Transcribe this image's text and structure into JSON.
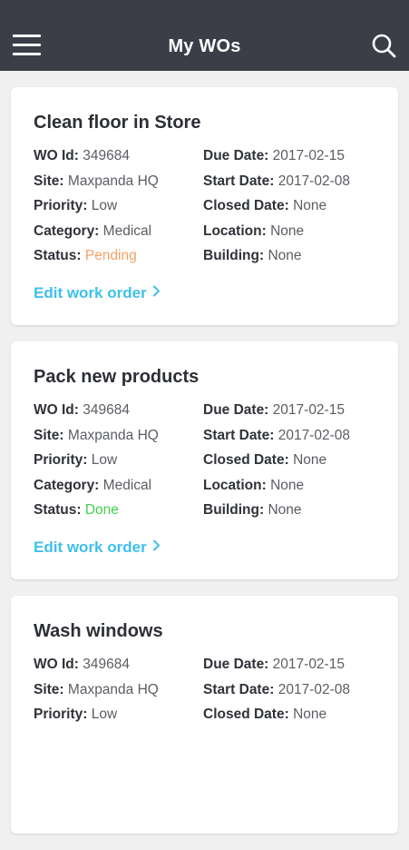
{
  "header": {
    "title": "My WOs",
    "menu_icon": "hamburger-menu-icon",
    "search_icon": "search-icon",
    "background": "#3b3e47"
  },
  "labels": {
    "wo_id": "WO Id:",
    "site": "Site:",
    "priority": "Priority:",
    "category": "Category:",
    "status": "Status:",
    "due_date": "Due Date:",
    "start_date": "Start Date:",
    "closed_date": "Closed Date:",
    "location": "Location:",
    "building": "Building:"
  },
  "colors": {
    "link": "#3fc0ea",
    "status_pending": "#f4a064",
    "status_done": "#44d24a"
  },
  "work_orders": [
    {
      "title": "Clean floor in Store",
      "wo_id": "349684",
      "site": "Maxpanda HQ",
      "priority": "Low",
      "category": "Medical",
      "status": "Pending",
      "due_date": "2017-02-15",
      "start_date": "2017-02-08",
      "closed_date": "None",
      "location": "None",
      "building": "None",
      "edit_label": "Edit work order"
    },
    {
      "title": "Pack new products",
      "wo_id": "349684",
      "site": "Maxpanda HQ",
      "priority": "Low",
      "category": "Medical",
      "status": "Done",
      "due_date": "2017-02-15",
      "start_date": "2017-02-08",
      "closed_date": "None",
      "location": "None",
      "building": "None",
      "edit_label": "Edit work order"
    },
    {
      "title": "Wash windows",
      "wo_id": "349684",
      "site": "Maxpanda HQ",
      "priority": "Low",
      "due_date": "2017-02-15",
      "start_date": "2017-02-08",
      "closed_date": "None"
    }
  ]
}
